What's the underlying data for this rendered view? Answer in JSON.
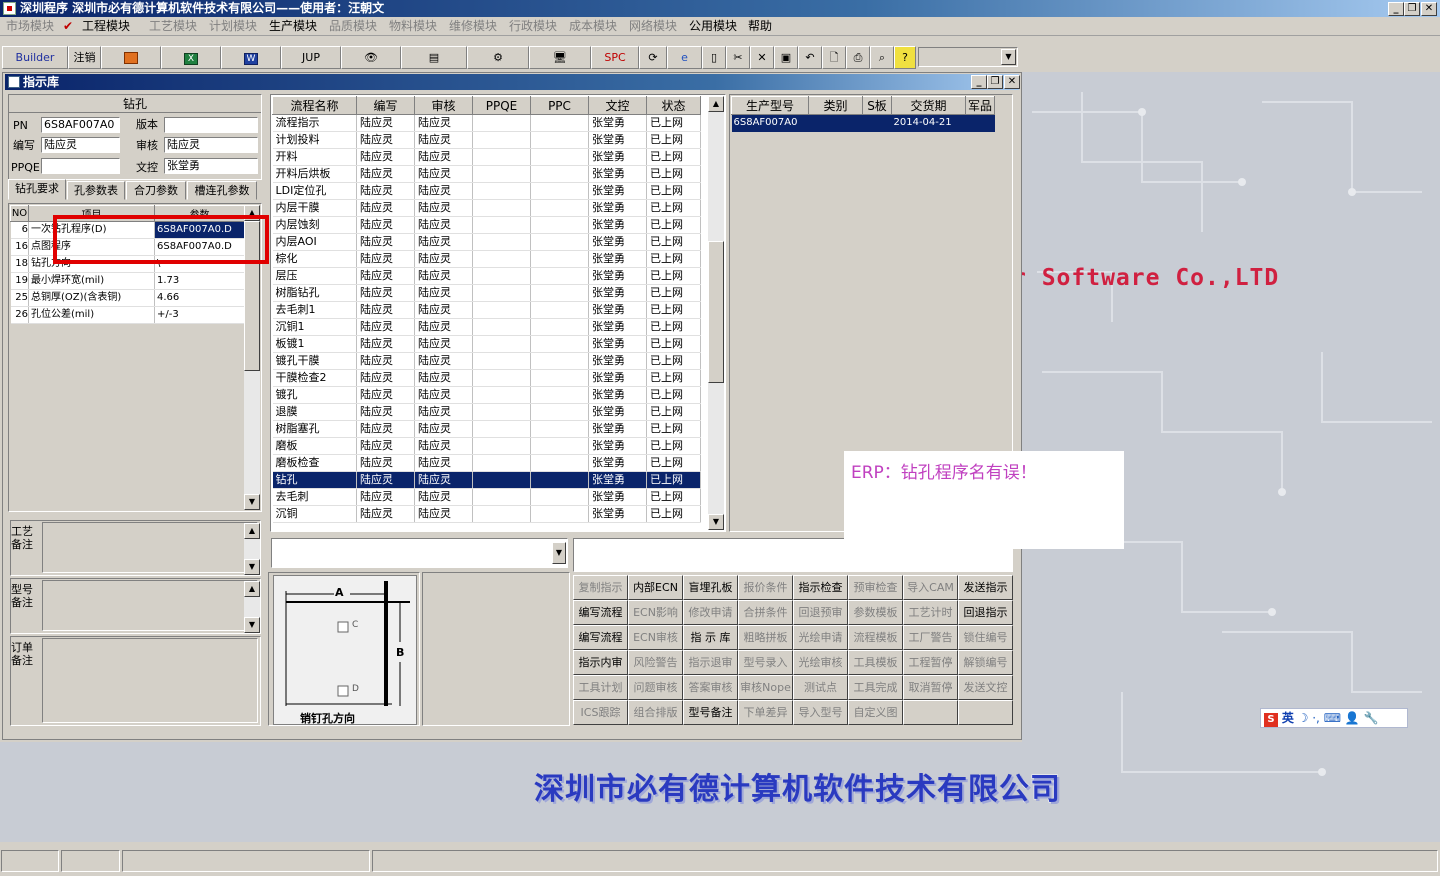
{
  "app": {
    "title": "深圳程序    深圳市必有德计算机软件技术有限公司——使用者：汪朝文",
    "child_title": "指示库"
  },
  "menu": {
    "items": [
      {
        "label": "市场模块",
        "enabled": false
      },
      {
        "label": "工程模块",
        "enabled": true,
        "checked": true
      },
      {
        "label": "工艺模块",
        "enabled": false
      },
      {
        "label": "计划模块",
        "enabled": false
      },
      {
        "label": "生产模块",
        "enabled": true
      },
      {
        "label": "品质模块",
        "enabled": false
      },
      {
        "label": "物料模块",
        "enabled": false
      },
      {
        "label": "维修模块",
        "enabled": false
      },
      {
        "label": "行政模块",
        "enabled": false
      },
      {
        "label": "成本模块",
        "enabled": false
      },
      {
        "label": "网络模块",
        "enabled": false
      },
      {
        "label": "公用模块",
        "enabled": true
      },
      {
        "label": "帮助",
        "enabled": true
      }
    ]
  },
  "toolbar": {
    "builder": "Builder",
    "logout": "注销",
    "jup": "JUP",
    "spc": "SPC"
  },
  "header": {
    "section_title": "钻孔",
    "pn_label": "PN",
    "pn_value": "6S8AF007A0",
    "version_label": "版本",
    "version_value": "",
    "writer_label": "编写",
    "writer_value": "陆应灵",
    "reviewer_label": "审核",
    "reviewer_value": "陆应灵",
    "ppqe_label": "PPQE",
    "ppqe_value": "",
    "doc_label": "文控",
    "doc_value": "张堂勇"
  },
  "tabs": [
    "钻孔要求",
    "孔参数表",
    "合刀参数",
    "槽连孔参数"
  ],
  "drill_table": {
    "columns": [
      "NO",
      "项目",
      "参数"
    ],
    "rows": [
      {
        "no": "6",
        "item": "一次钻孔程序(D)",
        "param": "6S8AF007A0.D"
      },
      {
        "no": "16",
        "item": "点图程序",
        "param": "6S8AF007A0.D"
      },
      {
        "no": "18",
        "item": "钻孔方向",
        "param": "\\"
      },
      {
        "no": "19",
        "item": "最小焊环宽(mil)",
        "param": "1.73"
      },
      {
        "no": "25",
        "item": "总铜厚(OZ)(含表铜)",
        "param": "4.66"
      },
      {
        "no": "26",
        "item": "孔位公差(mil)",
        "param": "+/-3"
      }
    ]
  },
  "remarks": [
    {
      "label": "工艺备注",
      "value": ""
    },
    {
      "label": "型号备注",
      "value": ""
    },
    {
      "label": "订单备注",
      "value": ""
    }
  ],
  "process_table": {
    "columns": [
      "流程名称",
      "编写",
      "审核",
      "PPQE",
      "PPC",
      "文控",
      "状态"
    ],
    "rows": [
      [
        "流程指示",
        "陆应灵",
        "陆应灵",
        "",
        "",
        "张堂勇",
        "已上网"
      ],
      [
        "计划投料",
        "陆应灵",
        "陆应灵",
        "",
        "",
        "张堂勇",
        "已上网"
      ],
      [
        "开料",
        "陆应灵",
        "陆应灵",
        "",
        "",
        "张堂勇",
        "已上网"
      ],
      [
        "开料后烘板",
        "陆应灵",
        "陆应灵",
        "",
        "",
        "张堂勇",
        "已上网"
      ],
      [
        "LDI定位孔",
        "陆应灵",
        "陆应灵",
        "",
        "",
        "张堂勇",
        "已上网"
      ],
      [
        "内层干膜",
        "陆应灵",
        "陆应灵",
        "",
        "",
        "张堂勇",
        "已上网"
      ],
      [
        "内层蚀刻",
        "陆应灵",
        "陆应灵",
        "",
        "",
        "张堂勇",
        "已上网"
      ],
      [
        "内层AOI",
        "陆应灵",
        "陆应灵",
        "",
        "",
        "张堂勇",
        "已上网"
      ],
      [
        "棕化",
        "陆应灵",
        "陆应灵",
        "",
        "",
        "张堂勇",
        "已上网"
      ],
      [
        "层压",
        "陆应灵",
        "陆应灵",
        "",
        "",
        "张堂勇",
        "已上网"
      ],
      [
        "树脂钻孔",
        "陆应灵",
        "陆应灵",
        "",
        "",
        "张堂勇",
        "已上网"
      ],
      [
        "去毛刺1",
        "陆应灵",
        "陆应灵",
        "",
        "",
        "张堂勇",
        "已上网"
      ],
      [
        "沉铜1",
        "陆应灵",
        "陆应灵",
        "",
        "",
        "张堂勇",
        "已上网"
      ],
      [
        "板镀1",
        "陆应灵",
        "陆应灵",
        "",
        "",
        "张堂勇",
        "已上网"
      ],
      [
        "镀孔干膜",
        "陆应灵",
        "陆应灵",
        "",
        "",
        "张堂勇",
        "已上网"
      ],
      [
        "干膜检查2",
        "陆应灵",
        "陆应灵",
        "",
        "",
        "张堂勇",
        "已上网"
      ],
      [
        "镀孔",
        "陆应灵",
        "陆应灵",
        "",
        "",
        "张堂勇",
        "已上网"
      ],
      [
        "退膜",
        "陆应灵",
        "陆应灵",
        "",
        "",
        "张堂勇",
        "已上网"
      ],
      [
        "树脂塞孔",
        "陆应灵",
        "陆应灵",
        "",
        "",
        "张堂勇",
        "已上网"
      ],
      [
        "磨板",
        "陆应灵",
        "陆应灵",
        "",
        "",
        "张堂勇",
        "已上网"
      ],
      [
        "磨板检查",
        "陆应灵",
        "陆应灵",
        "",
        "",
        "张堂勇",
        "已上网"
      ],
      [
        "钻孔",
        "陆应灵",
        "陆应灵",
        "",
        "",
        "张堂勇",
        "已上网"
      ],
      [
        "去毛刺",
        "陆应灵",
        "陆应灵",
        "",
        "",
        "张堂勇",
        "已上网"
      ],
      [
        "沉铜",
        "陆应灵",
        "陆应灵",
        "",
        "",
        "张堂勇",
        "已上网"
      ]
    ],
    "selected_index": 21
  },
  "order_table": {
    "columns": [
      "生产型号",
      "类别",
      "S板",
      "交货期",
      "军品"
    ],
    "rows": [
      [
        "6S8AF007A0",
        "",
        "",
        "2014-04-21",
        ""
      ]
    ]
  },
  "diagram": {
    "label_a": "A",
    "label_b": "B",
    "label_c": "C",
    "label_d": "D",
    "caption": "销钉孔方向"
  },
  "action_buttons": [
    {
      "label": "复制指示",
      "enabled": false
    },
    {
      "label": "内部ECN",
      "enabled": true
    },
    {
      "label": "盲埋孔板",
      "enabled": true
    },
    {
      "label": "报价条件",
      "enabled": false
    },
    {
      "label": "指示检查",
      "enabled": true
    },
    {
      "label": "预审检查",
      "enabled": false
    },
    {
      "label": "导入CAM",
      "enabled": false
    },
    {
      "label": "发送指示",
      "enabled": true
    },
    {
      "label": "编写流程",
      "enabled": true
    },
    {
      "label": "ECN影响",
      "enabled": false
    },
    {
      "label": "修改申请",
      "enabled": false
    },
    {
      "label": "合拼条件",
      "enabled": false
    },
    {
      "label": "回退预审",
      "enabled": false
    },
    {
      "label": "参数模板",
      "enabled": false
    },
    {
      "label": "工艺计时",
      "enabled": false
    },
    {
      "label": "回退指示",
      "enabled": true
    },
    {
      "label": "编写流程",
      "enabled": true
    },
    {
      "label": "ECN审核",
      "enabled": false
    },
    {
      "label": "指 示 库",
      "enabled": true
    },
    {
      "label": "粗略拼板",
      "enabled": false
    },
    {
      "label": "光绘申请",
      "enabled": false
    },
    {
      "label": "流程模板",
      "enabled": false
    },
    {
      "label": "工厂警告",
      "enabled": false
    },
    {
      "label": "锁住编号",
      "enabled": false
    },
    {
      "label": "指示内审",
      "enabled": true
    },
    {
      "label": "风险警告",
      "enabled": false
    },
    {
      "label": "指示退审",
      "enabled": false
    },
    {
      "label": "型号录入",
      "enabled": false
    },
    {
      "label": "光绘审核",
      "enabled": false
    },
    {
      "label": "工具模板",
      "enabled": false
    },
    {
      "label": "工程暂停",
      "enabled": false
    },
    {
      "label": "解锁编号",
      "enabled": false
    },
    {
      "label": "工具计划",
      "enabled": false
    },
    {
      "label": "问题审核",
      "enabled": false
    },
    {
      "label": "答案审核",
      "enabled": false
    },
    {
      "label": "审核Nope",
      "enabled": false
    },
    {
      "label": "测试点",
      "enabled": false
    },
    {
      "label": "工具完成",
      "enabled": false
    },
    {
      "label": "取消暂停",
      "enabled": false
    },
    {
      "label": "发送文控",
      "enabled": false
    },
    {
      "label": "ICS跟踪",
      "enabled": false
    },
    {
      "label": "组合排版",
      "enabled": false
    },
    {
      "label": "型号备注",
      "enabled": true
    },
    {
      "label": "下单差异",
      "enabled": false
    },
    {
      "label": "导入型号",
      "enabled": false
    },
    {
      "label": "自定义图",
      "enabled": false
    },
    {
      "label": "",
      "enabled": false
    },
    {
      "label": "",
      "enabled": false
    }
  ],
  "annotation": {
    "note": "ERP：钻孔程序名有误！",
    "color": "#c040c0",
    "highlight_color": "#e00000"
  },
  "desktop": {
    "slogan_partial": "r Software Co.,LTD",
    "company_banner": "深圳市必有德计算机软件技术有限公司",
    "ime_text": "英"
  }
}
